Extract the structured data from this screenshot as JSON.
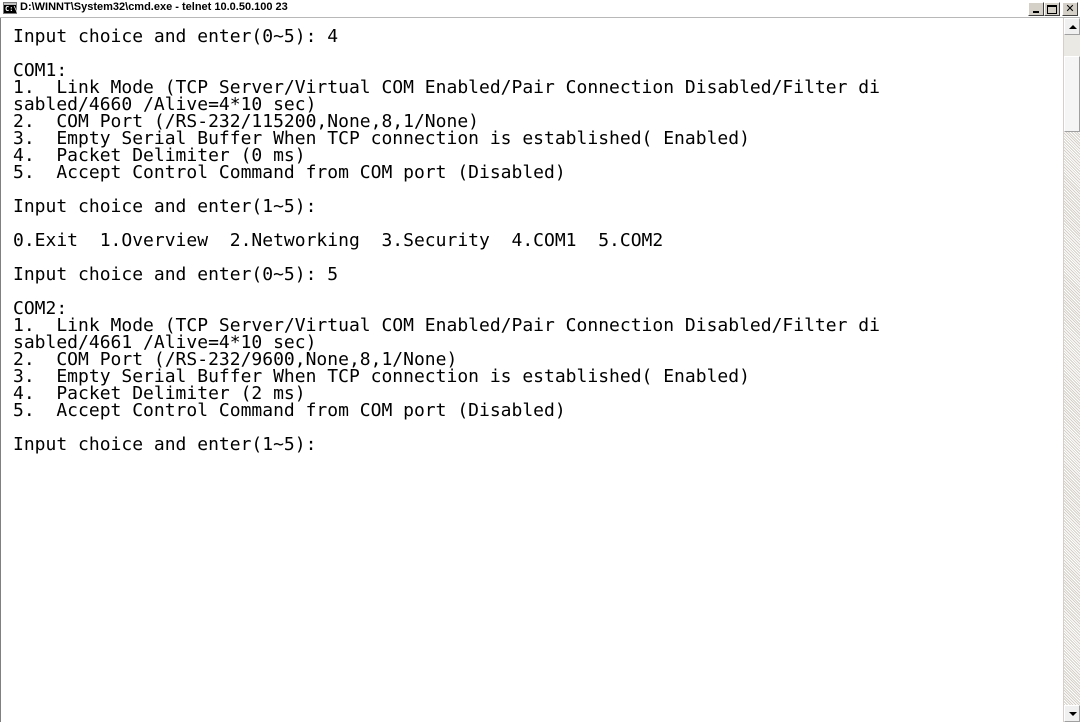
{
  "window": {
    "title": "D:\\WINNT\\System32\\cmd.exe - telnet 10.0.50.100 23",
    "icon": "console-icon",
    "controls": [
      "minimize-icon",
      "maximize-icon",
      "close-icon"
    ]
  },
  "terminal": {
    "colors": {
      "background": "#ffffff",
      "foreground": "#000000"
    },
    "lines": [
      "Input choice and enter(0~5): 4",
      "",
      "COM1:",
      "1.  Link Mode (TCP Server/Virtual COM Enabled/Pair Connection Disabled/Filter di",
      "sabled/4660 /Alive=4*10 sec)",
      "2.  COM Port (/RS-232/115200,None,8,1/None)",
      "3.  Empty Serial Buffer When TCP connection is established( Enabled)",
      "4.  Packet Delimiter (0 ms)",
      "5.  Accept Control Command from COM port (Disabled)",
      "",
      "Input choice and enter(1~5):",
      "",
      "0.Exit  1.Overview  2.Networking  3.Security  4.COM1  5.COM2",
      "",
      "Input choice and enter(0~5): 5",
      "",
      "COM2:",
      "1.  Link Mode (TCP Server/Virtual COM Enabled/Pair Connection Disabled/Filter di",
      "sabled/4661 /Alive=4*10 sec)",
      "2.  COM Port (/RS-232/9600,None,8,1/None)",
      "3.  Empty Serial Buffer When TCP connection is established( Enabled)",
      "4.  Packet Delimiter (2 ms)",
      "5.  Accept Control Command from COM port (Disabled)",
      "",
      "Input choice and enter(1~5):"
    ]
  },
  "scrollbar": {
    "up_icon": "scroll-up-arrow-icon",
    "down_icon": "scroll-down-arrow-icon"
  }
}
